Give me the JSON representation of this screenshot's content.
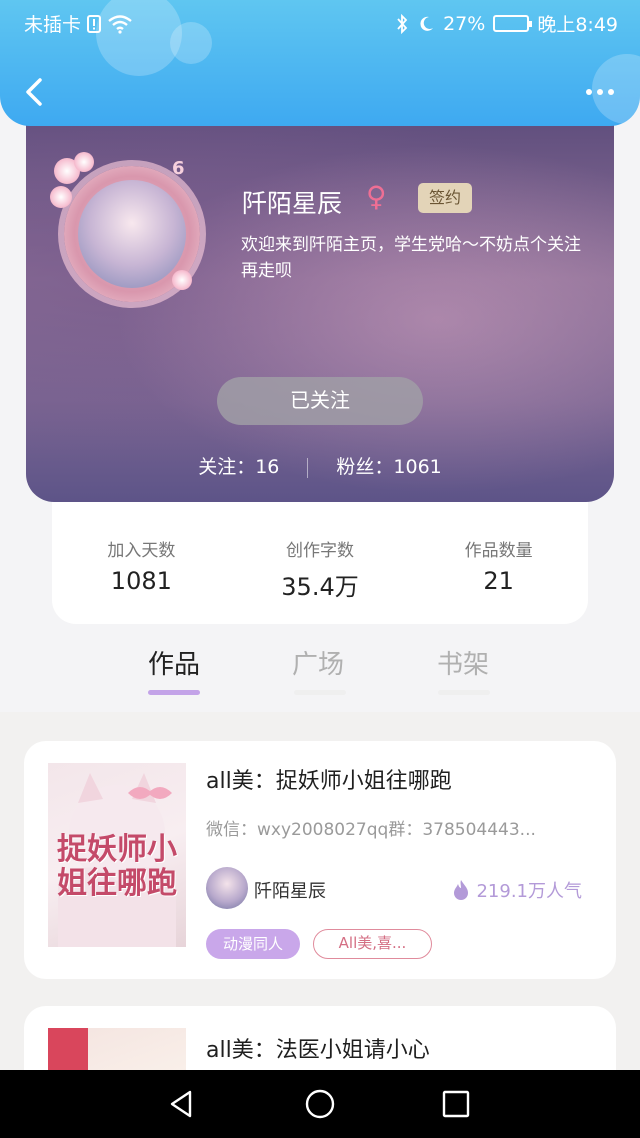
{
  "status_bar": {
    "carrier": "未插卡",
    "battery": "27%",
    "time": "晚上8:49"
  },
  "profile": {
    "level": "6",
    "name": "阡陌星辰",
    "gender_symbol": "♀",
    "sign_badge": "签约",
    "bio": "欢迎来到阡陌主页，学生党哈～不妨点个关注再走呗",
    "follow_button": "已关注",
    "following_label": "关注：16",
    "fans_label": "粉丝：1061"
  },
  "stats": [
    {
      "label": "加入天数",
      "value": "1081"
    },
    {
      "label": "创作字数",
      "value": "35.4万"
    },
    {
      "label": "作品数量",
      "value": "21"
    }
  ],
  "tabs": [
    {
      "label": "作品"
    },
    {
      "label": "广场"
    },
    {
      "label": "书架"
    }
  ],
  "books": [
    {
      "cover_text": "捉妖师小姐往哪跑",
      "title": "all美：捉妖师小姐往哪跑",
      "desc": "微信：wxy2008027qq群：378504443...",
      "author": "阡陌星辰",
      "popularity": "219.1万人气",
      "tags": [
        "动漫同人",
        "All美,喜..."
      ]
    },
    {
      "title": "all美：法医小姐请小心"
    }
  ],
  "colors": {
    "accent_purple": "#c3a3e8",
    "header_blue": "#3ea9f1",
    "gender_pink": "#ee6f94"
  }
}
